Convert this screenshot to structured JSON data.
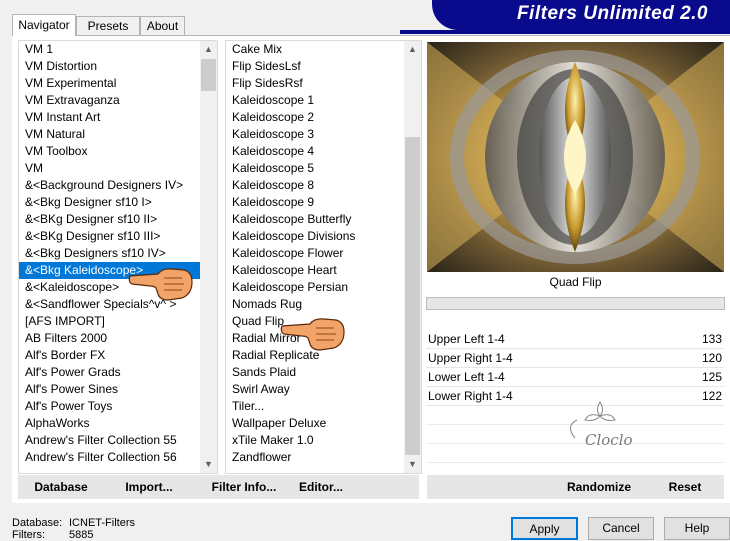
{
  "banner": {
    "title": "Filters Unlimited 2.0"
  },
  "tabs": [
    "Navigator",
    "Presets",
    "About"
  ],
  "categories": [
    "VM 1",
    "VM Distortion",
    "VM Experimental",
    "VM Extravaganza",
    "VM Instant Art",
    "VM Natural",
    "VM Toolbox",
    "VM",
    "&<Background Designers IV>",
    "&<Bkg Designer sf10 I>",
    "&<BKg Designer sf10 II>",
    "&<BKg Designer sf10 III>",
    "&<Bkg Designers sf10 IV>",
    "&<Bkg Kaleidoscope>",
    "&<Kaleidoscope>",
    "&<Sandflower Specials^v^ >",
    "[AFS IMPORT]",
    "AB Filters 2000",
    "Alf's Border FX",
    "Alf's Power Grads",
    "Alf's Power Sines",
    "Alf's Power Toys",
    "AlphaWorks",
    "Andrew's Filter Collection 55",
    "Andrew's Filter Collection 56"
  ],
  "filters": [
    "Cake Mix",
    "Flip SidesLsf",
    "Flip SidesRsf",
    "Kaleidoscope 1",
    "Kaleidoscope 2",
    "Kaleidoscope 3",
    "Kaleidoscope 4",
    "Kaleidoscope 5",
    "Kaleidoscope 8",
    "Kaleidoscope 9",
    "Kaleidoscope Butterfly",
    "Kaleidoscope Divisions",
    "Kaleidoscope Flower",
    "Kaleidoscope Heart",
    "Kaleidoscope Persian",
    "Nomads Rug",
    "Quad Flip",
    "Radial Mirror",
    "Radial Replicate",
    "Sands Plaid",
    "Swirl Away",
    "Tiler...",
    "Wallpaper Deluxe",
    "xTile Maker 1.0",
    "Zandflower"
  ],
  "preview_label": "Quad Flip",
  "params": [
    {
      "name": "Upper Left 1-4",
      "value": "133"
    },
    {
      "name": "Upper Right 1-4",
      "value": "120"
    },
    {
      "name": "Lower Left 1-4",
      "value": "125"
    },
    {
      "name": "Lower Right 1-4",
      "value": "122"
    }
  ],
  "toolbar": {
    "database": "Database",
    "import": "Import...",
    "filter_info": "Filter Info...",
    "editor": "Editor...",
    "randomize": "Randomize",
    "reset": "Reset"
  },
  "status": {
    "database_label": "Database:",
    "database_value": "ICNET-Filters",
    "filters_label": "Filters:",
    "filters_value": "5885"
  },
  "buttons": {
    "apply": "Apply",
    "cancel": "Cancel",
    "help": "Help"
  },
  "watermark": "Cloclo",
  "colors": {
    "banner": "#0a0a8c",
    "selection": "#0078d7"
  }
}
